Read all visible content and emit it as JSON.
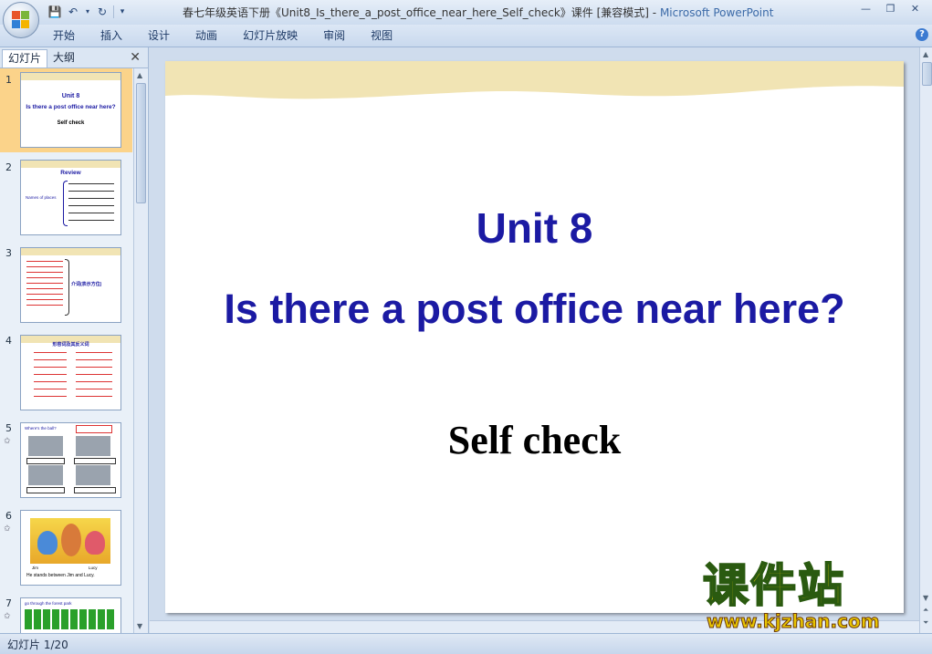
{
  "window": {
    "title": "春七年级英语下册《Unit8_Is_there_a_post_office_near_here_Self_check》课件 [兼容模式] - ",
    "app": "Microsoft PowerPoint"
  },
  "ribbon": {
    "tabs": [
      "开始",
      "插入",
      "设计",
      "动画",
      "幻灯片放映",
      "审阅",
      "视图"
    ]
  },
  "panel": {
    "tab_slides": "幻灯片",
    "tab_outline": "大纲"
  },
  "thumbnails": [
    {
      "num": "1",
      "l1": "Unit 8",
      "l2": "Is there a post office near here?",
      "l3": "Self check"
    },
    {
      "num": "2",
      "l1": "Review",
      "l2": "Names of places"
    },
    {
      "num": "3",
      "l1": "介词(表示方位)"
    },
    {
      "num": "4",
      "l1": "形容词及其反义词"
    },
    {
      "num": "5",
      "l1": "Where's the ball?"
    },
    {
      "num": "6",
      "l1": "He stands between Jim and Lucy.",
      "l2": "Jim",
      "l3": "Lucy"
    },
    {
      "num": "7",
      "l1": "go through the forest park"
    }
  ],
  "slide": {
    "line1": "Unit 8",
    "line2": "Is there a post office near here?",
    "line3": "Self check"
  },
  "status": {
    "text": "幻灯片 1/20"
  },
  "watermark": {
    "cn": "课件站",
    "url": "www.kjzhan.com"
  }
}
